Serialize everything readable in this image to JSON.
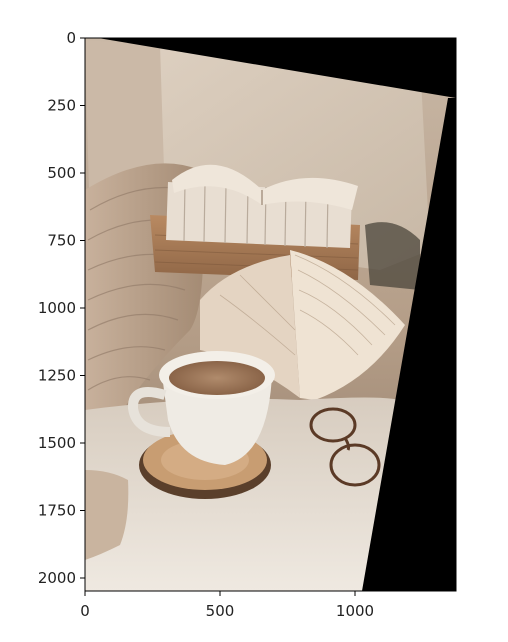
{
  "figure": {
    "image_subject": "photo",
    "x_ticks": [
      "0",
      "500",
      "1000"
    ],
    "y_ticks": [
      "0",
      "250",
      "500",
      "750",
      "1000",
      "1250",
      "1500",
      "1750",
      "2000"
    ],
    "x_tick_values": [
      0,
      500,
      1000
    ],
    "y_tick_values": [
      0,
      250,
      500,
      750,
      1000,
      1250,
      1500,
      1750,
      2000
    ],
    "x_range": [
      0,
      1370
    ],
    "y_range": [
      2050,
      0
    ],
    "colors": {
      "frame": "#000000",
      "background": "#ffffff",
      "black_fill": "#000000"
    }
  }
}
